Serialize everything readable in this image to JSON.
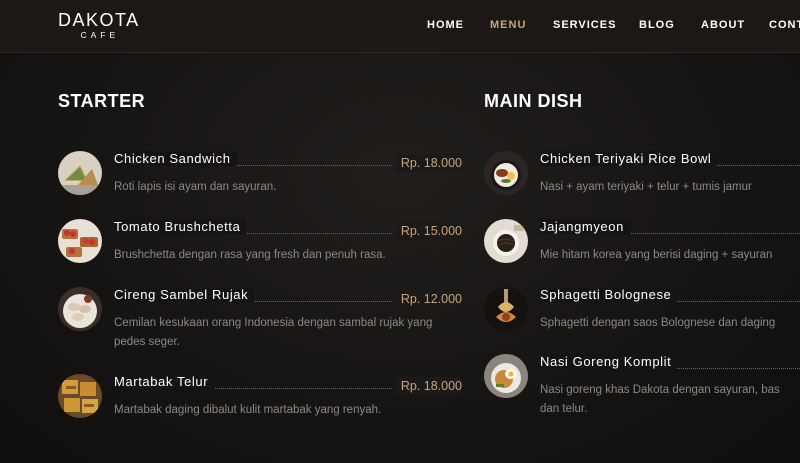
{
  "header": {
    "logo_main": "DAKOTA",
    "logo_sub": "CAFE",
    "nav": [
      {
        "label": "HOME"
      },
      {
        "label": "MENU"
      },
      {
        "label": "SERVICES"
      },
      {
        "label": "BLOG"
      },
      {
        "label": "ABOUT"
      },
      {
        "label": "CONT"
      }
    ]
  },
  "colors": {
    "accent": "#c8a47e",
    "background": "#141212",
    "text": "#ffffff",
    "muted": "#8c8884"
  },
  "starter": {
    "title": "STARTER",
    "items": [
      {
        "name": "Chicken Sandwich",
        "price": "Rp. 18.000",
        "desc": "Roti lapis isi ayam dan sayuran.",
        "image_icon": "sandwich-photo"
      },
      {
        "name": "Tomato Brushchetta",
        "price": "Rp. 15.000",
        "desc": "Brushchetta dengan rasa yang fresh dan penuh rasa.",
        "image_icon": "bruschetta-photo"
      },
      {
        "name": "Cireng Sambel Rujak",
        "price": "Rp. 12.000",
        "desc": "Cemilan kesukaan orang Indonesia dengan sambal rujak yang pedes seger.",
        "image_icon": "cireng-photo"
      },
      {
        "name": "Martabak Telur",
        "price": "Rp. 18.000",
        "desc": "Martabak daging dibalut kulit martabak yang renyah.",
        "image_icon": "martabak-photo"
      }
    ]
  },
  "main_dish": {
    "title": "MAIN DISH",
    "items": [
      {
        "name": "Chicken Teriyaki Rice Bowl",
        "desc": "Nasi + ayam teriyaki + telur + tumis jamur",
        "image_icon": "rice-bowl-photo"
      },
      {
        "name": "Jajangmyeon",
        "desc": "Mie hitam korea yang berisi daging + sayuran",
        "image_icon": "noodles-photo"
      },
      {
        "name": "Sphagetti Bolognese",
        "desc": "Sphagetti dengan saos Bolognese dan daging",
        "image_icon": "spaghetti-photo"
      },
      {
        "name": "Nasi Goreng Komplit",
        "desc": "Nasi goreng khas Dakota dengan sayuran, bas dan telur.",
        "image_icon": "fried-rice-photo"
      }
    ]
  }
}
